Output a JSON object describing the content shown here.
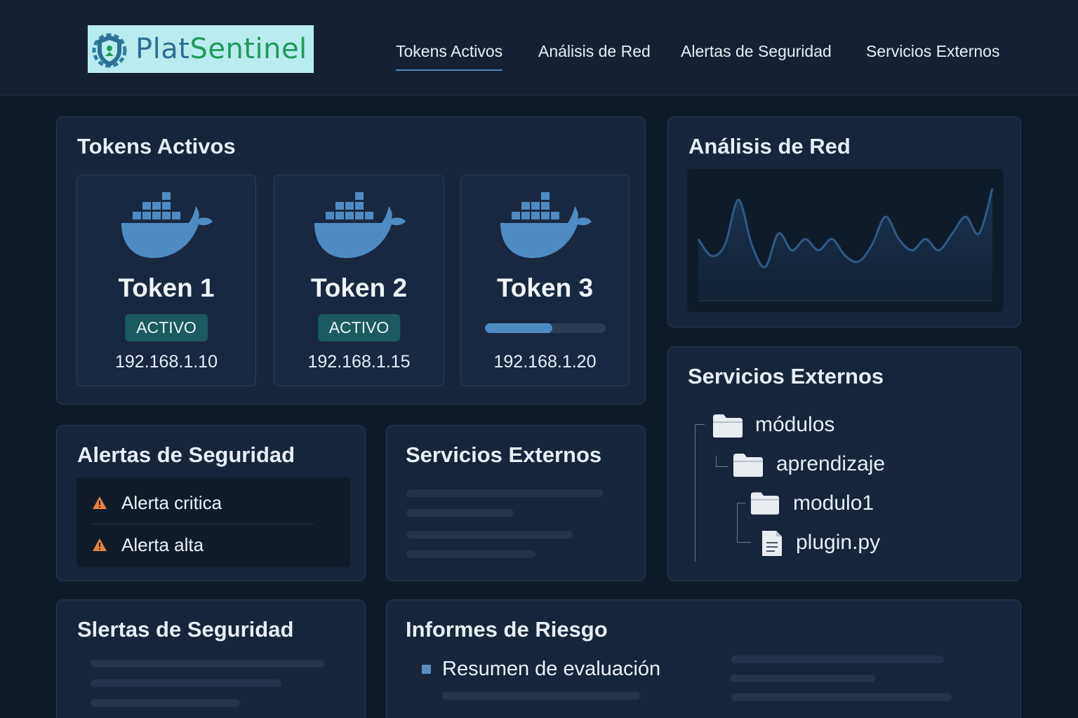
{
  "brand": {
    "name_part1": "Plat",
    "name_part2": "Sentinel",
    "icon": "shield-gear-icon"
  },
  "nav": {
    "items": [
      {
        "label": "Tokens  Activos",
        "active": true
      },
      {
        "label": "Análisis de Red",
        "active": false
      },
      {
        "label": "Alertas de Seguridad",
        "active": false
      },
      {
        "label": "Servicios Externos",
        "active": false
      }
    ]
  },
  "tokens_panel": {
    "title": "Tokens Activos",
    "tokens": [
      {
        "name": "Token 1",
        "status": "ACTIVO",
        "ip": "192.168.1.10",
        "icon": "docker-whale-icon"
      },
      {
        "name": "Token 2",
        "status": "ACTIVO",
        "ip": "192.168.1.15",
        "icon": "docker-whale-icon"
      },
      {
        "name": "Token 3",
        "progress": 0.56,
        "ip": "192.168.1.20",
        "icon": "docker-whale-icon"
      }
    ]
  },
  "network_panel": {
    "title": "Análisis de Red",
    "chart_data": {
      "type": "area",
      "y": [
        0.55,
        0.4,
        0.5,
        0.9,
        0.5,
        0.3,
        0.6,
        0.45,
        0.55,
        0.45,
        0.55,
        0.4,
        0.35,
        0.5,
        0.75,
        0.55,
        0.45,
        0.55,
        0.45,
        0.6,
        0.75,
        0.6,
        1.0
      ]
    }
  },
  "alerts_panel": {
    "title": "Alertas de Seguridad",
    "items": [
      {
        "label": "Alerta critica",
        "icon": "warning-icon"
      },
      {
        "label": "Alerta alta",
        "icon": "warning-icon"
      }
    ]
  },
  "external_services_small": {
    "title": "Servicios Externos"
  },
  "external_services_tree": {
    "title": "Servicios Externos",
    "nodes": [
      {
        "label": "módulos",
        "icon": "folder-icon"
      },
      {
        "label": "aprendizaje",
        "icon": "folder-icon"
      },
      {
        "label": "modulo1",
        "icon": "folder-icon"
      },
      {
        "label": "plugin.py",
        "icon": "file-icon"
      }
    ]
  },
  "alerts_panel_2": {
    "title": "Slertas de Seguridad"
  },
  "risk_reports": {
    "title": "Informes de Riesgo",
    "item": "Resumen de evaluación"
  },
  "colors": {
    "background": "#0f1a28",
    "card": "#17253a",
    "accent": "#4f8bc3",
    "badge": "#1b5a5e",
    "warning": "#e8823a"
  }
}
